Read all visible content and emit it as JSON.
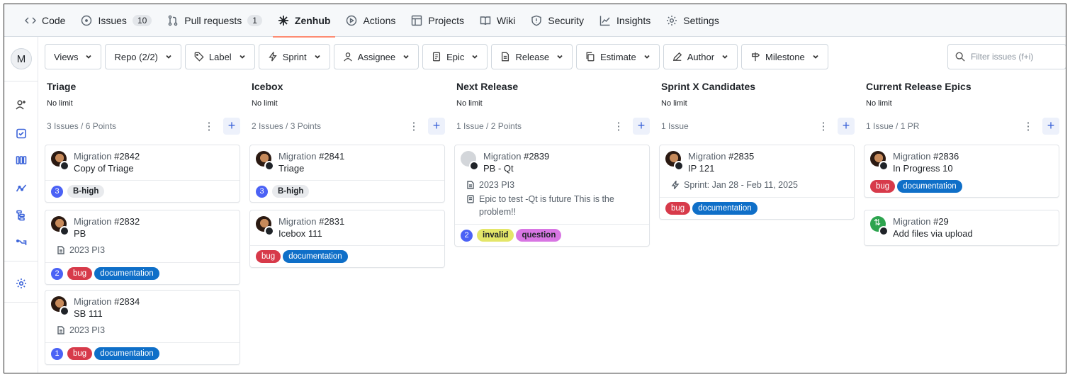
{
  "repo_nav": {
    "tabs": [
      {
        "label": "Code",
        "icon": "code-icon"
      },
      {
        "label": "Issues",
        "icon": "issue-icon",
        "count": "10"
      },
      {
        "label": "Pull requests",
        "icon": "pull-request-icon",
        "count": "1"
      },
      {
        "label": "Zenhub",
        "icon": "zenhub-icon",
        "active": true
      },
      {
        "label": "Actions",
        "icon": "play-icon"
      },
      {
        "label": "Projects",
        "icon": "table-icon"
      },
      {
        "label": "Wiki",
        "icon": "book-icon"
      },
      {
        "label": "Security",
        "icon": "shield-icon"
      },
      {
        "label": "Insights",
        "icon": "graph-icon"
      },
      {
        "label": "Settings",
        "icon": "gear-icon"
      }
    ]
  },
  "sidebar": {
    "avatar_letter": "M",
    "items": [
      "add-user-icon",
      "board-check-icon",
      "board-columns-icon",
      "roadmap-icon",
      "hierarchy-icon",
      "dependencies-icon",
      "gear-icon"
    ]
  },
  "filters": {
    "views": "Views",
    "repo": "Repo (2/2)",
    "label": "Label",
    "sprint": "Sprint",
    "assignee": "Assignee",
    "epic": "Epic",
    "release": "Release",
    "estimate": "Estimate",
    "author": "Author",
    "milestone": "Milestone",
    "search_placeholder": "Filter issues (f+i)"
  },
  "columns": [
    {
      "title": "Triage",
      "limit": "No limit",
      "stats": "3 Issues / 6 Points",
      "cards": [
        {
          "repo": "Migration",
          "number": "#2842",
          "title": "Copy of Triage",
          "estimate": "3",
          "labels": [
            {
              "text": "B-high",
              "kind": "bhigh"
            }
          ]
        },
        {
          "repo": "Migration",
          "number": "#2832",
          "title": "PB",
          "release": "2023 PI3",
          "estimate": "2",
          "labels": [
            {
              "text": "bug",
              "kind": "bug"
            },
            {
              "text": "documentation",
              "kind": "doc"
            }
          ]
        },
        {
          "repo": "Migration",
          "number": "#2834",
          "title": "SB 111",
          "release": "2023 PI3",
          "estimate": "1",
          "labels": [
            {
              "text": "bug",
              "kind": "bug"
            },
            {
              "text": "documentation",
              "kind": "doc"
            }
          ]
        }
      ]
    },
    {
      "title": "Icebox",
      "limit": "No limit",
      "stats": "2 Issues / 3 Points",
      "cards": [
        {
          "repo": "Migration",
          "number": "#2841",
          "title": "Triage",
          "estimate": "3",
          "labels": [
            {
              "text": "B-high",
              "kind": "bhigh"
            }
          ]
        },
        {
          "repo": "Migration",
          "number": "#2831",
          "title": "Icebox 111",
          "labels": [
            {
              "text": "bug",
              "kind": "bug"
            },
            {
              "text": "documentation",
              "kind": "doc"
            }
          ]
        }
      ]
    },
    {
      "title": "Next Release",
      "limit": "No limit",
      "stats": "1 Issue / 2 Points",
      "cards": [
        {
          "repo": "Migration",
          "number": "#2839",
          "title": "PB - Qt",
          "release": "2023 PI3",
          "epic": "Epic to test -Qt is future This is the problem!!",
          "estimate": "2",
          "avatar": "grey",
          "labels": [
            {
              "text": "invalid",
              "kind": "invalid"
            },
            {
              "text": "question",
              "kind": "question"
            }
          ]
        }
      ]
    },
    {
      "title": "Sprint X Candidates",
      "limit": "No limit",
      "stats": "1 Issue",
      "cards": [
        {
          "repo": "Migration",
          "number": "#2835",
          "title": "IP 121",
          "sprint": "Sprint: Jan 28 - Feb 11, 2025",
          "labels": [
            {
              "text": "bug",
              "kind": "bug"
            },
            {
              "text": "documentation",
              "kind": "doc"
            }
          ]
        }
      ]
    },
    {
      "title": "Current Release Epics",
      "limit": "No limit",
      "stats": "1 Issue / 1 PR",
      "cards": [
        {
          "repo": "Migration",
          "number": "#2836",
          "title": "In Progress 10",
          "labels": [
            {
              "text": "bug",
              "kind": "bug"
            },
            {
              "text": "documentation",
              "kind": "doc"
            }
          ]
        },
        {
          "repo": "Migration",
          "number": "#29",
          "title": "Add files via upload",
          "avatar": "green",
          "pr": true,
          "labels": []
        }
      ]
    }
  ]
}
